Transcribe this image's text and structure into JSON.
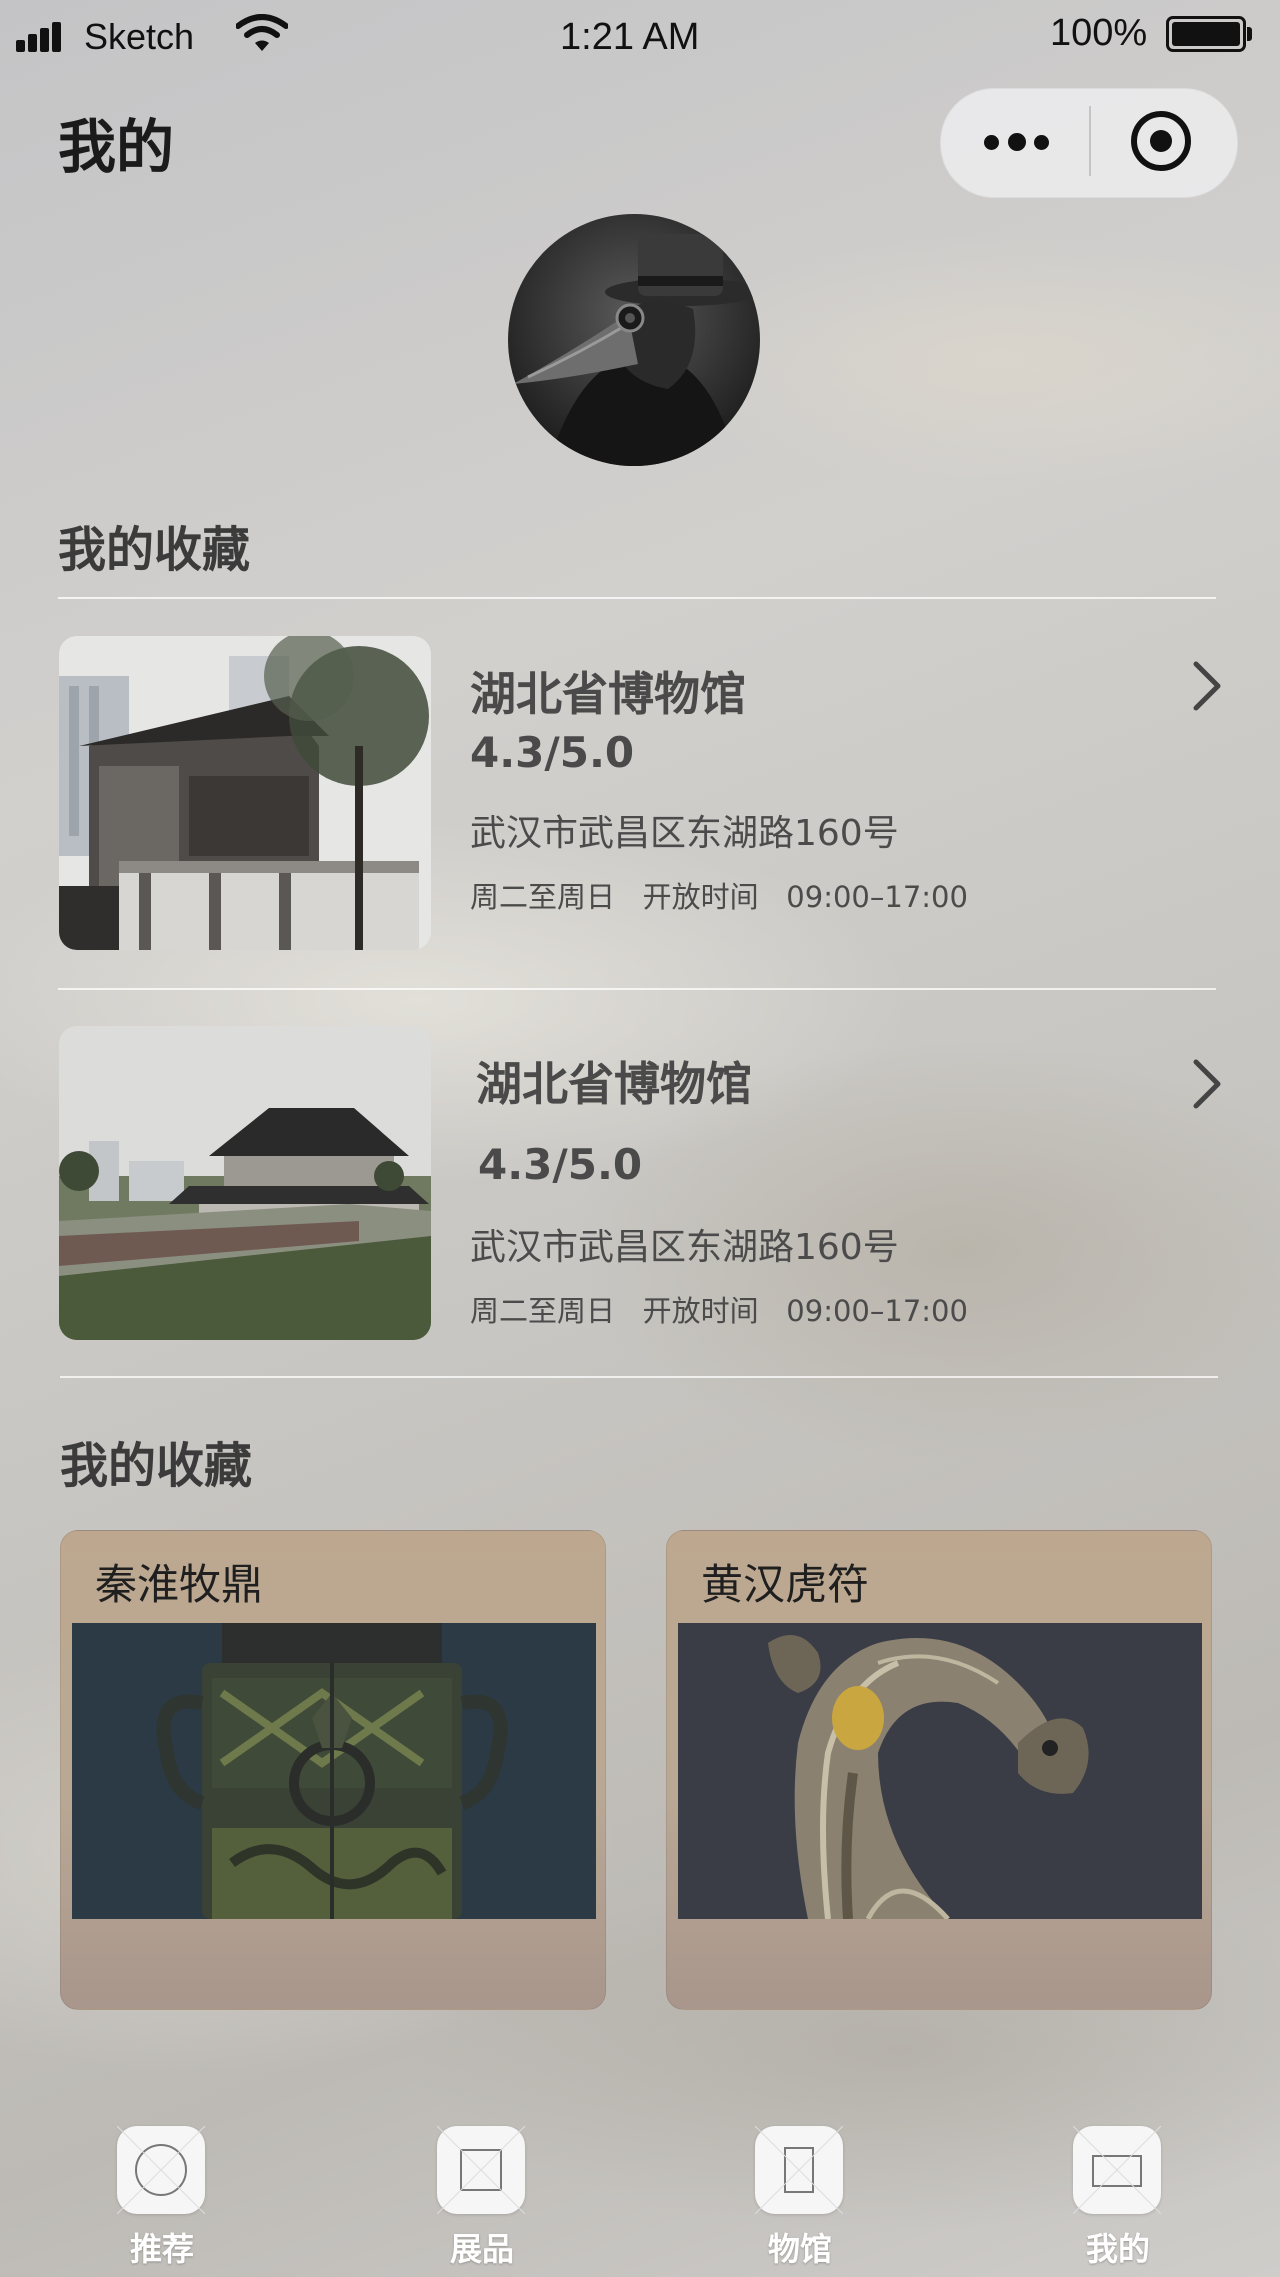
{
  "status_bar": {
    "carrier": "Sketch",
    "time": "1:21 AM",
    "battery_percent": "100%",
    "battery_level": 1.0
  },
  "nav": {
    "title": "我的",
    "more_icon": "more-dots-icon",
    "close_icon": "target-circle-icon"
  },
  "profile": {
    "avatar_description_icon": "avatar"
  },
  "museum_section": {
    "title": "我的收藏",
    "items": [
      {
        "name": "湖北省博物馆",
        "rating": "4.3/5.0",
        "address": "武汉市武昌区东湖路160号",
        "hours": "周二至周日   开放时间   09:00–17:00"
      },
      {
        "name": "湖北省博物馆",
        "rating": "4.3/5.0",
        "address": "武汉市武昌区东湖路160号",
        "hours": "周二至周日   开放时间   09:00–17:00"
      }
    ]
  },
  "artifact_section": {
    "title": "我的收藏",
    "items": [
      {
        "name": "秦淮牧鼎"
      },
      {
        "name": "黄汉虎符"
      }
    ]
  },
  "tab_bar": {
    "items": [
      {
        "label": "推荐",
        "icon": "circle-placeholder-icon"
      },
      {
        "label": "展品",
        "icon": "square-placeholder-icon"
      },
      {
        "label": "物馆",
        "icon": "portrait-placeholder-icon"
      },
      {
        "label": "我的",
        "icon": "landscape-placeholder-icon"
      }
    ]
  },
  "colors": {
    "card_gradient_top": "#bda88f",
    "card_gradient_bottom": "#a9968c",
    "text_primary": "#3a3a3a",
    "tab_label": "#ffffff"
  }
}
